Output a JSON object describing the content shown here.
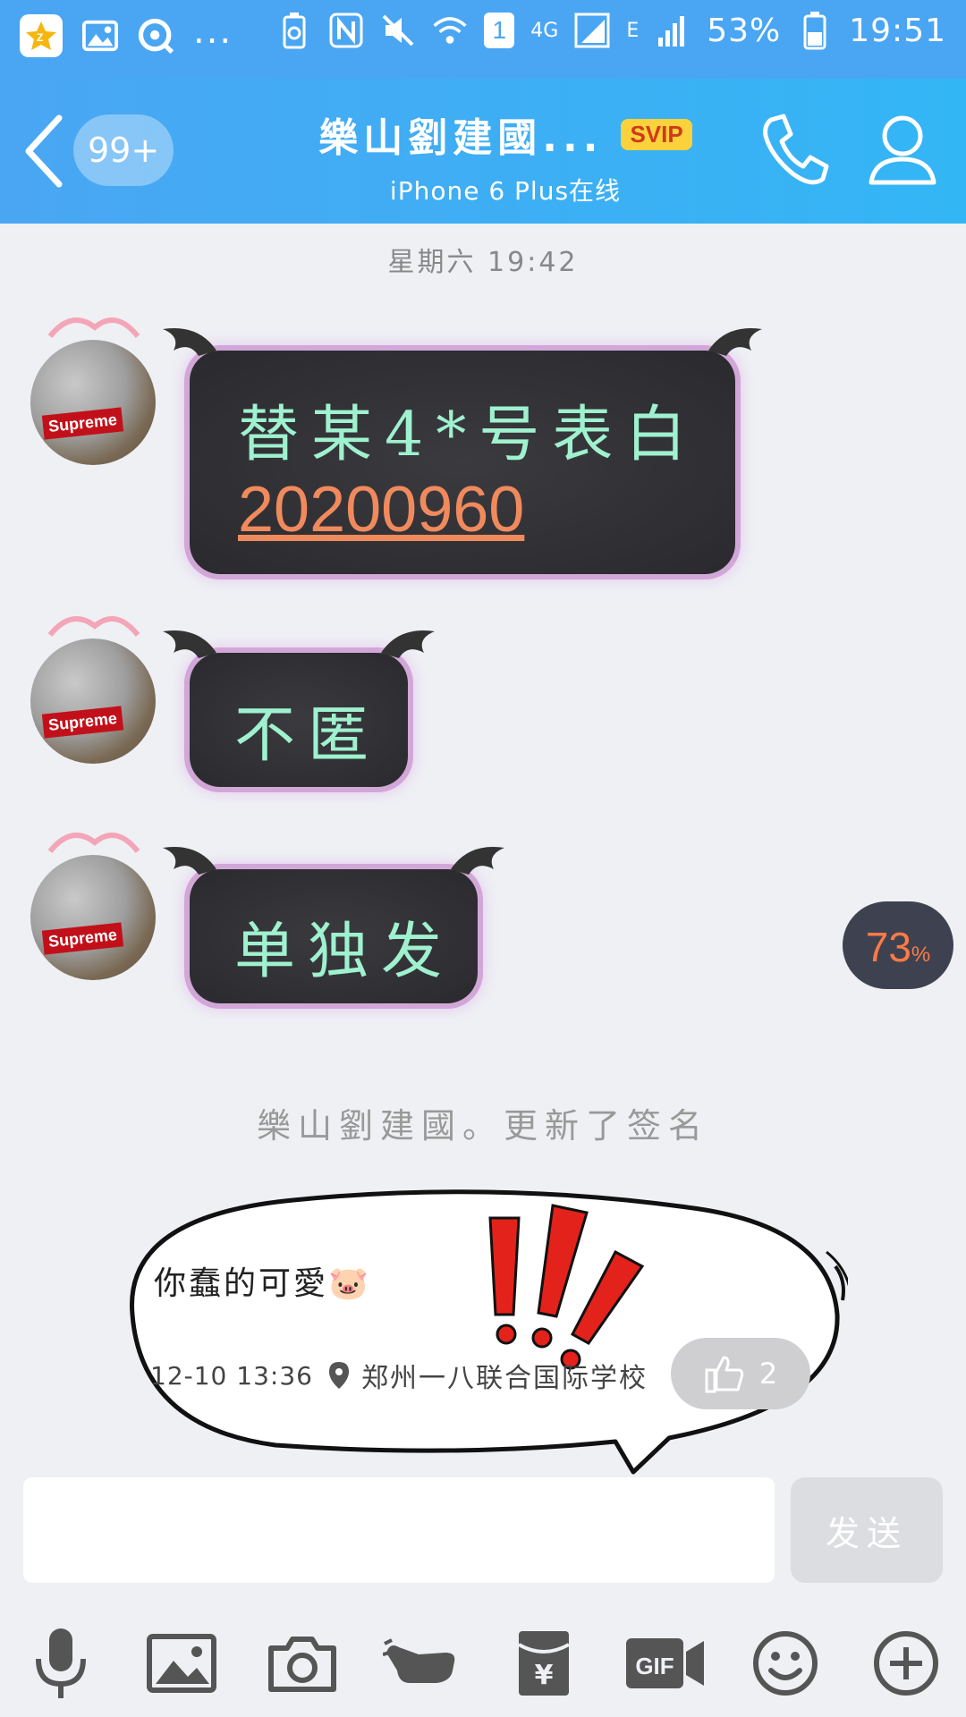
{
  "status_bar": {
    "dots": "...",
    "sim_slot": "1",
    "network": "4G",
    "network2": "E",
    "battery": "53%",
    "time": "19:51"
  },
  "header": {
    "unread": "99+",
    "title": "樂山劉建國...",
    "vip": "SVIP",
    "subtitle": "iPhone 6 Plus在线"
  },
  "chat": {
    "timestamp": "星期六 19:42",
    "messages": [
      {
        "line1": "替某4*号表白",
        "line2": "20200960"
      },
      {
        "text": "不匿"
      },
      {
        "text": "单独发"
      }
    ],
    "progress": {
      "value": "73",
      "unit": "%"
    },
    "system_notice": "樂山劉建國。更新了签名"
  },
  "signature": {
    "text": "你蠢的可愛🐷",
    "time": "12-10 13:36",
    "location": "郑州一八联合国际学校",
    "likes": "2"
  },
  "input": {
    "send_label": "发送"
  },
  "toolbar": {
    "icons": [
      "microphone-icon",
      "image-icon",
      "camera-icon",
      "hand-icon",
      "red-packet-icon",
      "gif-icon",
      "emoji-icon",
      "plus-icon"
    ],
    "gif_label": "GIF",
    "yuan": "¥"
  },
  "colors": {
    "header_blue": "#4aa6f3",
    "bubble_text": "#9ff1cf",
    "link_orange": "#f08a5d",
    "progress_text": "#ff7a45"
  }
}
